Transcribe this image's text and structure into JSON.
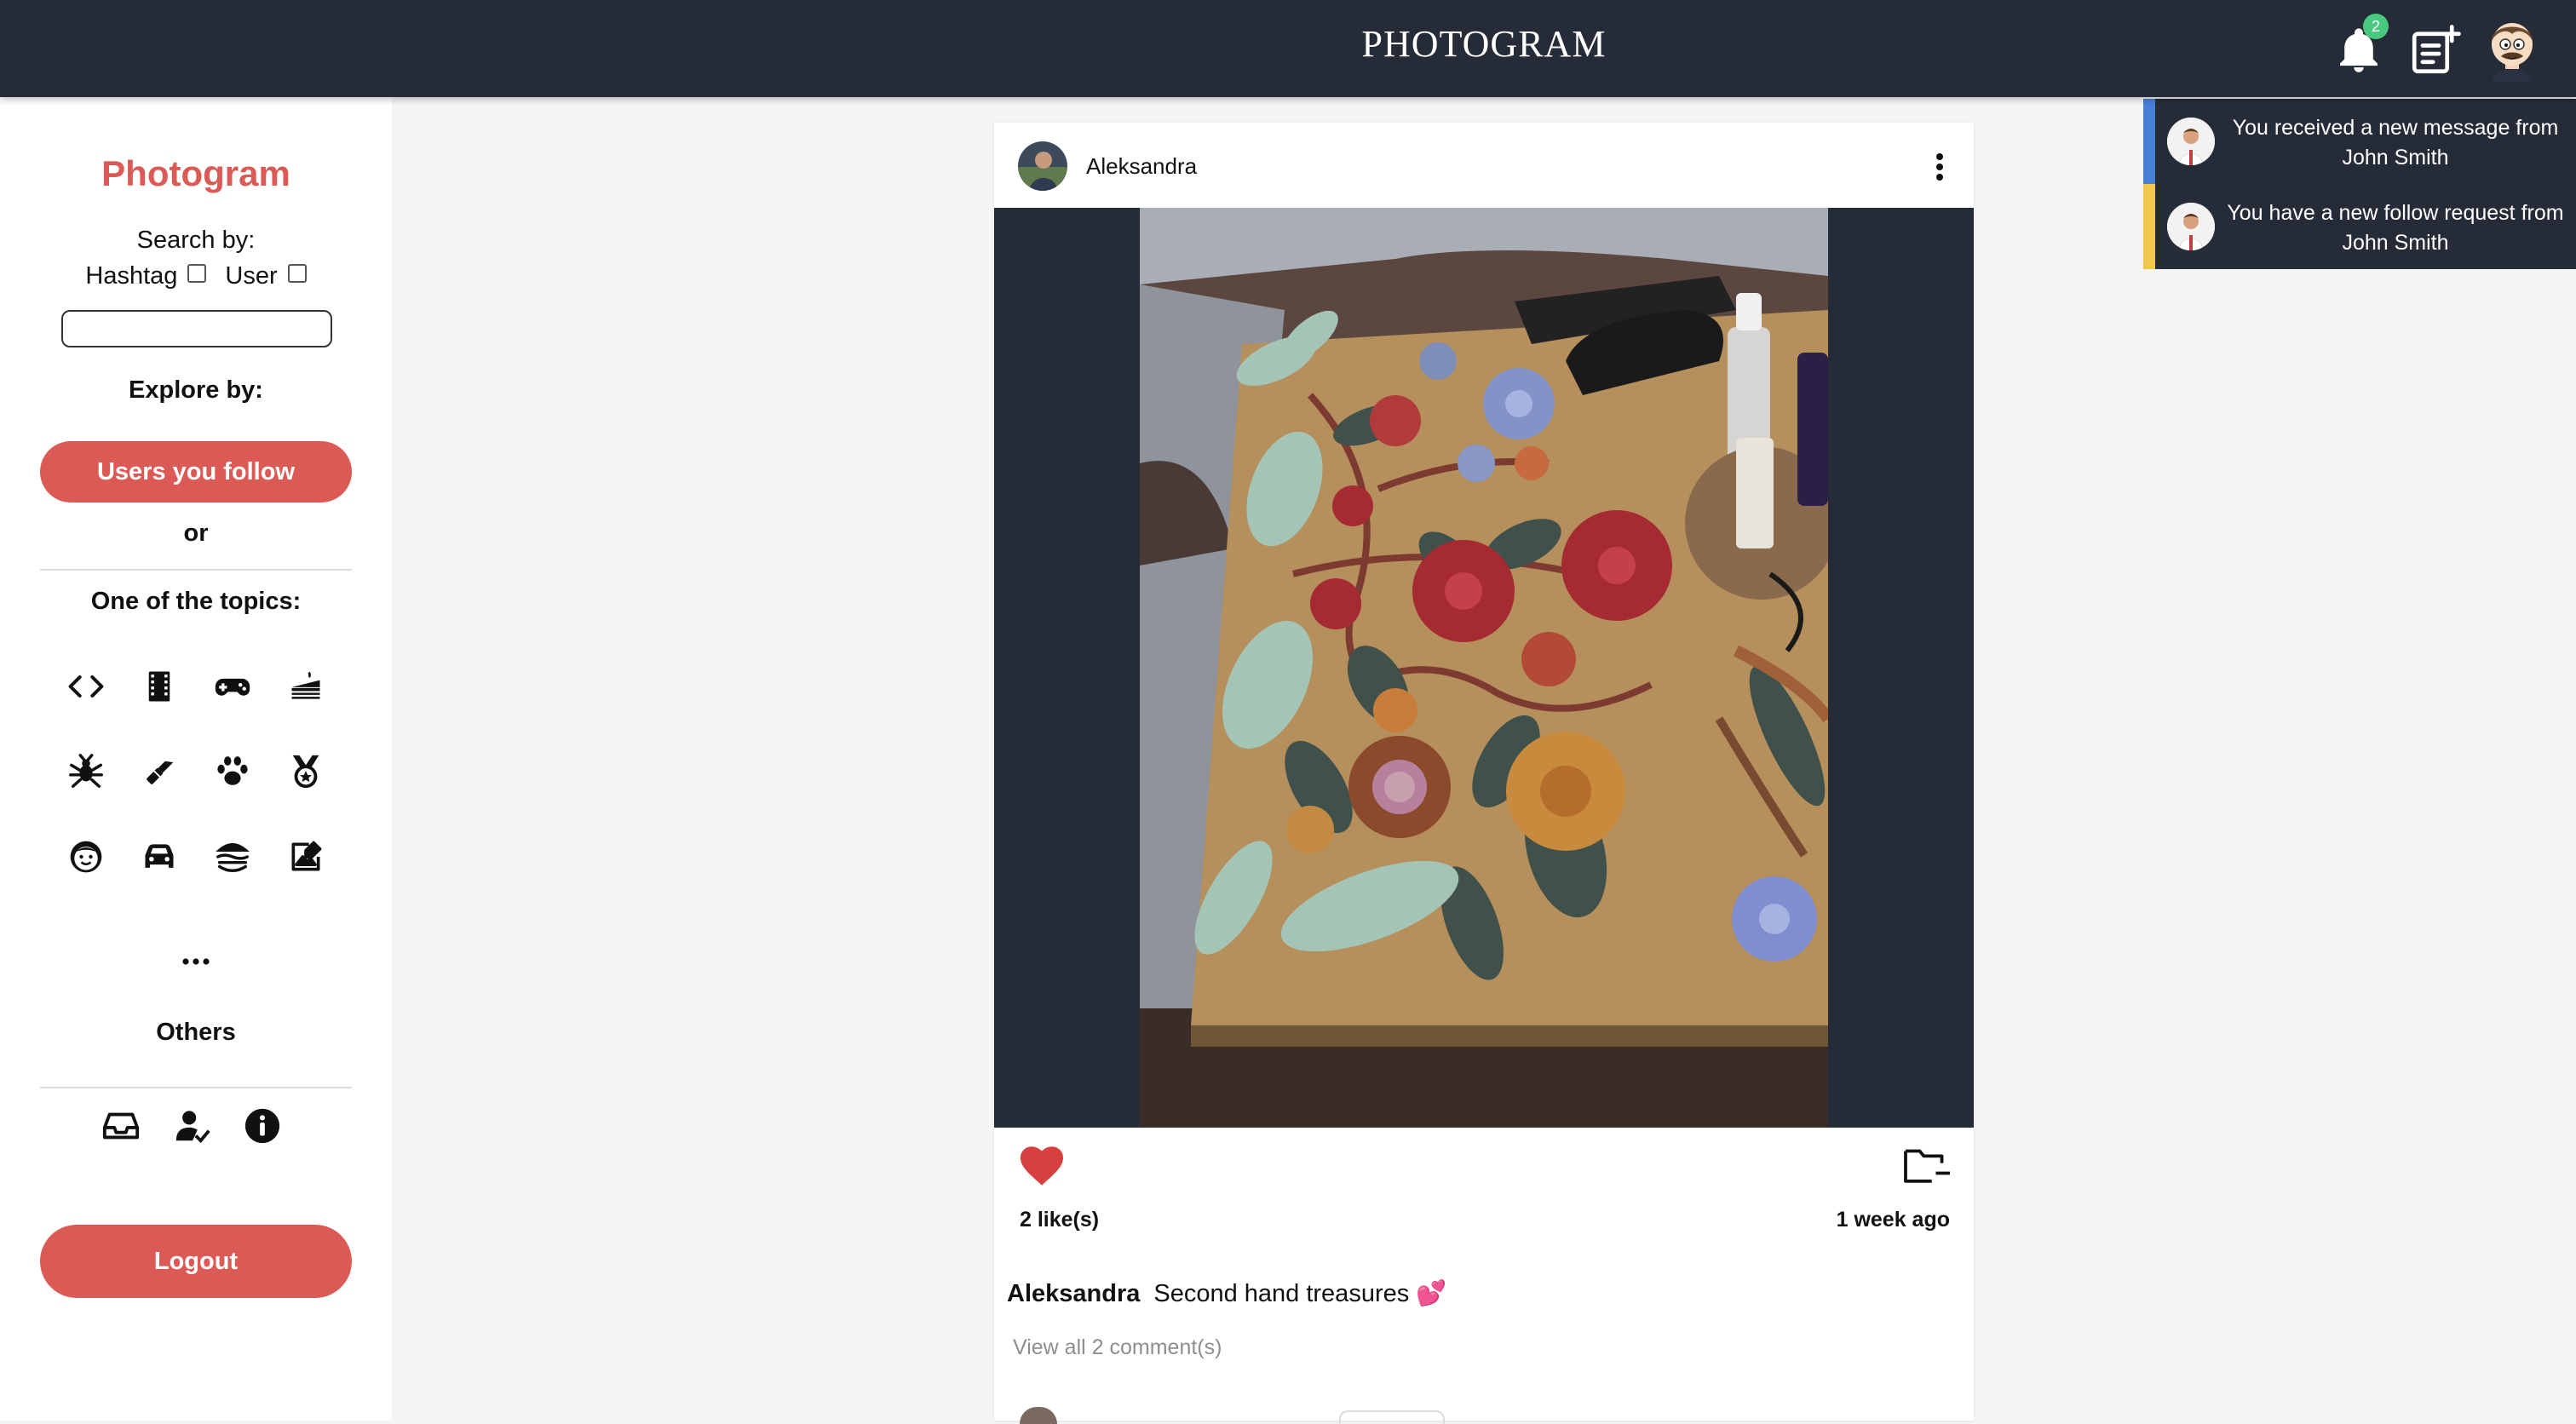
{
  "app": {
    "brand": "PHOTOGRAM",
    "notification_count": "2"
  },
  "sidebar": {
    "logo": "Photogram",
    "search_by_label": "Search by:",
    "hashtag_label": "Hashtag",
    "user_label": "User",
    "search_value": "",
    "explore_label": "Explore by:",
    "follow_button": "Users you follow",
    "or_label": "or",
    "topics_label": "One of the topics:",
    "topics": [
      "code-icon",
      "film-icon",
      "gamepad-icon",
      "cake-icon",
      "bug-icon",
      "lipstick-icon",
      "paw-icon",
      "medal-icon",
      "child-face-icon",
      "car-icon",
      "hamburger-icon",
      "photo-edit-icon"
    ],
    "others_label": "Others",
    "other_icons": [
      "inbox-icon",
      "user-check-icon",
      "info-icon"
    ],
    "logout_button": "Logout"
  },
  "post": {
    "username": "Aleksandra",
    "likes": "2 like(s)",
    "time": "1 week ago",
    "caption_user": "Aleksandra",
    "caption_text": "Second hand treasures 💕",
    "comments_link": "View all 2 comment(s)"
  },
  "notifications": [
    {
      "text": "You received a new message from John Smith",
      "accent": "#4a7fd6"
    },
    {
      "text": "You have a new follow request from John Smith",
      "accent": "#f0c94a"
    }
  ],
  "colors": {
    "topbar": "#252c38",
    "accent": "#dc5a55",
    "heart": "#d84040",
    "badge": "#49c97f"
  }
}
